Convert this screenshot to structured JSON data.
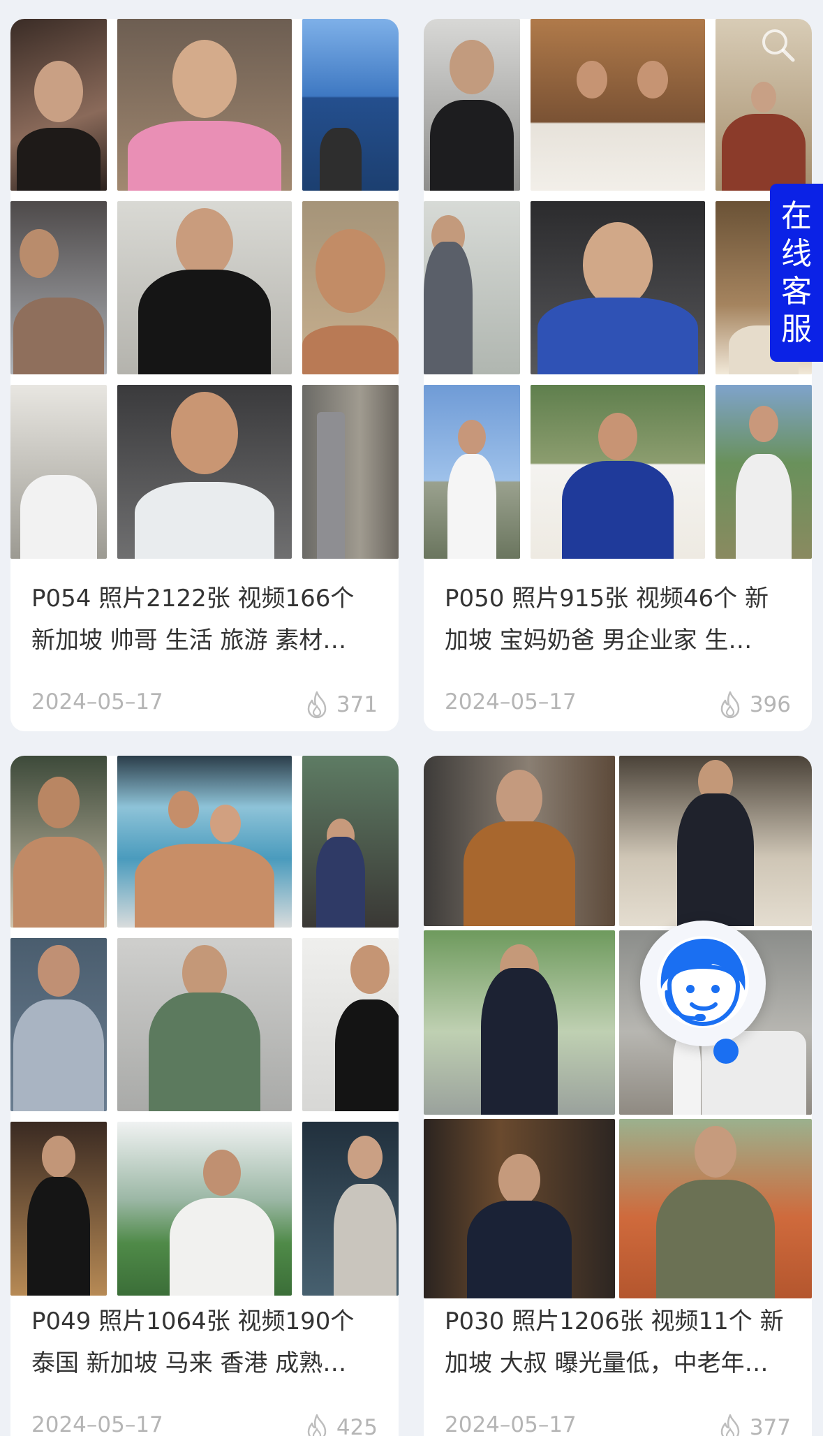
{
  "cards": [
    {
      "caption": "P054 照片2122张 视频166个 新加坡 帅哥 生活 旅游 素材…",
      "date": "2024–05–17",
      "views": "371"
    },
    {
      "caption": "P050 照片915张 视频46个 新加坡 宝妈奶爸 男企业家 生…",
      "date": "2024–05–17",
      "views": "396"
    },
    {
      "caption": "P049 照片1064张 视频190个 泰国 新加坡 马来 香港 成熟…",
      "date": "2024–05–17",
      "views": "425"
    },
    {
      "caption": "P030 照片1206张 视频11个 新加坡 大叔 曝光量低，中老年…",
      "date": "2024–05–17",
      "views": "377"
    }
  ],
  "customer_service": {
    "label_chars": [
      "在",
      "线",
      "客",
      "服"
    ],
    "color": "#0b22e6"
  },
  "icons": {
    "views": "flame-icon",
    "support": "customer-service-icon",
    "search": "search-icon"
  }
}
